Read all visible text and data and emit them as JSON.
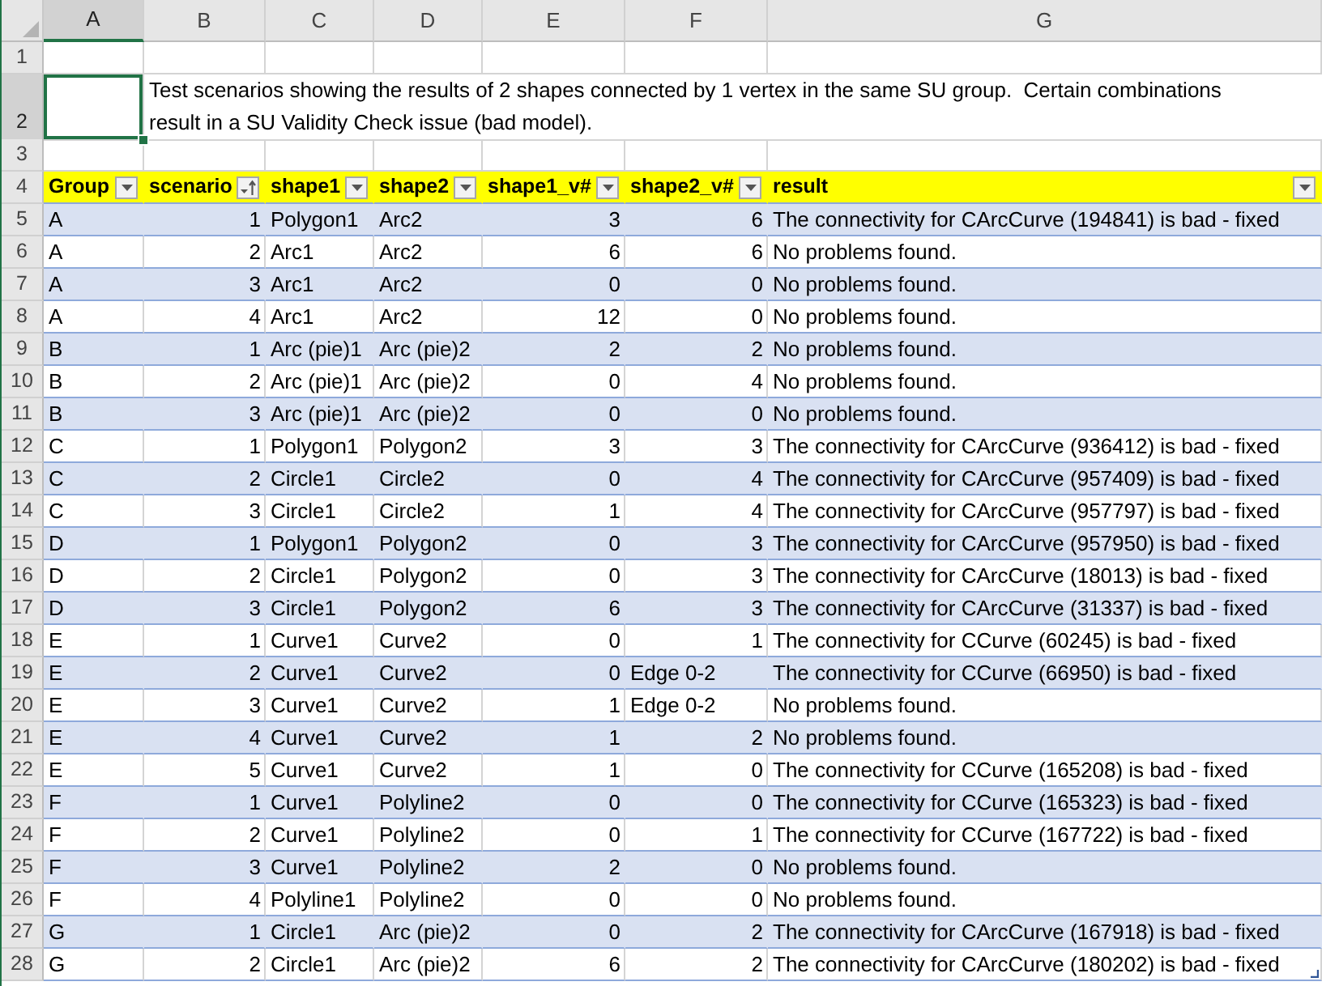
{
  "column_headers": [
    {
      "label": "A",
      "selected": true
    },
    {
      "label": "B",
      "selected": false
    },
    {
      "label": "C",
      "selected": false
    },
    {
      "label": "D",
      "selected": false
    },
    {
      "label": "E",
      "selected": false
    },
    {
      "label": "F",
      "selected": false
    },
    {
      "label": "G",
      "selected": false
    }
  ],
  "row_headers": [
    {
      "label": "1",
      "selected": false
    },
    {
      "label": "2",
      "selected": true
    },
    {
      "label": "3",
      "selected": false
    },
    {
      "label": "4",
      "selected": false
    },
    {
      "label": "5",
      "selected": false
    },
    {
      "label": "6",
      "selected": false
    },
    {
      "label": "7",
      "selected": false
    },
    {
      "label": "8",
      "selected": false
    },
    {
      "label": "9",
      "selected": false
    },
    {
      "label": "10",
      "selected": false
    },
    {
      "label": "11",
      "selected": false
    },
    {
      "label": "12",
      "selected": false
    },
    {
      "label": "13",
      "selected": false
    },
    {
      "label": "14",
      "selected": false
    },
    {
      "label": "15",
      "selected": false
    },
    {
      "label": "16",
      "selected": false
    },
    {
      "label": "17",
      "selected": false
    },
    {
      "label": "18",
      "selected": false
    },
    {
      "label": "19",
      "selected": false
    },
    {
      "label": "20",
      "selected": false
    },
    {
      "label": "21",
      "selected": false
    },
    {
      "label": "22",
      "selected": false
    },
    {
      "label": "23",
      "selected": false
    },
    {
      "label": "24",
      "selected": false
    },
    {
      "label": "25",
      "selected": false
    },
    {
      "label": "26",
      "selected": false
    },
    {
      "label": "27",
      "selected": false
    },
    {
      "label": "28",
      "selected": false
    }
  ],
  "note": "Test scenarios showing the results of 2 shapes connected by 1 vertex in the same SU group.  Certain combinations result in a SU Validity Check issue (bad model).",
  "table": {
    "columns": [
      {
        "label": "Group",
        "sorted": false
      },
      {
        "label": "scenario",
        "sorted": true
      },
      {
        "label": "shape1",
        "sorted": false
      },
      {
        "label": "shape2",
        "sorted": false
      },
      {
        "label": "shape1_v#",
        "sorted": false
      },
      {
        "label": "shape2_v#",
        "sorted": false
      },
      {
        "label": "result",
        "sorted": false
      }
    ],
    "rows": [
      {
        "cells": [
          {
            "text": "A",
            "kind": "text"
          },
          {
            "text": "1",
            "kind": "number"
          },
          {
            "text": "Polygon1",
            "kind": "text"
          },
          {
            "text": "Arc2",
            "kind": "text"
          },
          {
            "text": "3",
            "kind": "number"
          },
          {
            "text": "6",
            "kind": "number"
          },
          {
            "text": "The connectivity for CArcCurve (194841) is bad - fixed",
            "kind": "text"
          }
        ]
      },
      {
        "cells": [
          {
            "text": "A",
            "kind": "text"
          },
          {
            "text": "2",
            "kind": "number"
          },
          {
            "text": "Arc1",
            "kind": "text"
          },
          {
            "text": "Arc2",
            "kind": "text"
          },
          {
            "text": "6",
            "kind": "number"
          },
          {
            "text": "6",
            "kind": "number"
          },
          {
            "text": "No problems found.",
            "kind": "text"
          }
        ]
      },
      {
        "cells": [
          {
            "text": "A",
            "kind": "text"
          },
          {
            "text": "3",
            "kind": "number"
          },
          {
            "text": "Arc1",
            "kind": "text"
          },
          {
            "text": "Arc2",
            "kind": "text"
          },
          {
            "text": "0",
            "kind": "number"
          },
          {
            "text": "0",
            "kind": "number"
          },
          {
            "text": "No problems found.",
            "kind": "text"
          }
        ]
      },
      {
        "cells": [
          {
            "text": "A",
            "kind": "text"
          },
          {
            "text": "4",
            "kind": "number"
          },
          {
            "text": "Arc1",
            "kind": "text"
          },
          {
            "text": "Arc2",
            "kind": "text"
          },
          {
            "text": "12",
            "kind": "number"
          },
          {
            "text": "0",
            "kind": "number"
          },
          {
            "text": "No problems found.",
            "kind": "text"
          }
        ]
      },
      {
        "cells": [
          {
            "text": "B",
            "kind": "text"
          },
          {
            "text": "1",
            "kind": "number"
          },
          {
            "text": "Arc (pie)1",
            "kind": "text"
          },
          {
            "text": "Arc (pie)2",
            "kind": "text"
          },
          {
            "text": "2",
            "kind": "number"
          },
          {
            "text": "2",
            "kind": "number"
          },
          {
            "text": "No problems found.",
            "kind": "text"
          }
        ]
      },
      {
        "cells": [
          {
            "text": "B",
            "kind": "text"
          },
          {
            "text": "2",
            "kind": "number"
          },
          {
            "text": "Arc (pie)1",
            "kind": "text"
          },
          {
            "text": "Arc (pie)2",
            "kind": "text"
          },
          {
            "text": "0",
            "kind": "number"
          },
          {
            "text": "4",
            "kind": "number"
          },
          {
            "text": "No problems found.",
            "kind": "text"
          }
        ]
      },
      {
        "cells": [
          {
            "text": "B",
            "kind": "text"
          },
          {
            "text": "3",
            "kind": "number"
          },
          {
            "text": "Arc (pie)1",
            "kind": "text"
          },
          {
            "text": "Arc (pie)2",
            "kind": "text"
          },
          {
            "text": "0",
            "kind": "number"
          },
          {
            "text": "0",
            "kind": "number"
          },
          {
            "text": "No problems found.",
            "kind": "text"
          }
        ]
      },
      {
        "cells": [
          {
            "text": "C",
            "kind": "text"
          },
          {
            "text": "1",
            "kind": "number"
          },
          {
            "text": "Polygon1",
            "kind": "text"
          },
          {
            "text": "Polygon2",
            "kind": "text"
          },
          {
            "text": "3",
            "kind": "number"
          },
          {
            "text": "3",
            "kind": "number"
          },
          {
            "text": "The connectivity for CArcCurve (936412) is bad - fixed",
            "kind": "text"
          }
        ]
      },
      {
        "cells": [
          {
            "text": "C",
            "kind": "text"
          },
          {
            "text": "2",
            "kind": "number"
          },
          {
            "text": "Circle1",
            "kind": "text"
          },
          {
            "text": "Circle2",
            "kind": "text"
          },
          {
            "text": "0",
            "kind": "number"
          },
          {
            "text": "4",
            "kind": "number"
          },
          {
            "text": "The connectivity for CArcCurve (957409) is bad - fixed",
            "kind": "text"
          }
        ]
      },
      {
        "cells": [
          {
            "text": "C",
            "kind": "text"
          },
          {
            "text": "3",
            "kind": "number"
          },
          {
            "text": "Circle1",
            "kind": "text"
          },
          {
            "text": "Circle2",
            "kind": "text"
          },
          {
            "text": "1",
            "kind": "number"
          },
          {
            "text": "4",
            "kind": "number"
          },
          {
            "text": "The connectivity for CArcCurve (957797) is bad - fixed",
            "kind": "text"
          }
        ]
      },
      {
        "cells": [
          {
            "text": "D",
            "kind": "text"
          },
          {
            "text": "1",
            "kind": "number"
          },
          {
            "text": "Polygon1",
            "kind": "text"
          },
          {
            "text": "Polygon2",
            "kind": "text"
          },
          {
            "text": "0",
            "kind": "number"
          },
          {
            "text": "3",
            "kind": "number"
          },
          {
            "text": "The connectivity for CArcCurve (957950) is bad - fixed",
            "kind": "text"
          }
        ]
      },
      {
        "cells": [
          {
            "text": "D",
            "kind": "text"
          },
          {
            "text": "2",
            "kind": "number"
          },
          {
            "text": "Circle1",
            "kind": "text"
          },
          {
            "text": "Polygon2",
            "kind": "text"
          },
          {
            "text": "0",
            "kind": "number"
          },
          {
            "text": "3",
            "kind": "number"
          },
          {
            "text": "The connectivity for CArcCurve (18013) is bad - fixed",
            "kind": "text"
          }
        ]
      },
      {
        "cells": [
          {
            "text": "D",
            "kind": "text"
          },
          {
            "text": "3",
            "kind": "number"
          },
          {
            "text": "Circle1",
            "kind": "text"
          },
          {
            "text": "Polygon2",
            "kind": "text"
          },
          {
            "text": "6",
            "kind": "number"
          },
          {
            "text": "3",
            "kind": "number"
          },
          {
            "text": "The connectivity for CArcCurve (31337) is bad - fixed",
            "kind": "text"
          }
        ]
      },
      {
        "cells": [
          {
            "text": "E",
            "kind": "text"
          },
          {
            "text": "1",
            "kind": "number"
          },
          {
            "text": "Curve1",
            "kind": "text"
          },
          {
            "text": "Curve2",
            "kind": "text"
          },
          {
            "text": "0",
            "kind": "number"
          },
          {
            "text": "1",
            "kind": "number"
          },
          {
            "text": "The connectivity for CCurve (60245) is bad - fixed",
            "kind": "text"
          }
        ]
      },
      {
        "cells": [
          {
            "text": "E",
            "kind": "text"
          },
          {
            "text": "2",
            "kind": "number"
          },
          {
            "text": "Curve1",
            "kind": "text"
          },
          {
            "text": "Curve2",
            "kind": "text"
          },
          {
            "text": "0",
            "kind": "number"
          },
          {
            "text": "Edge 0-2",
            "kind": "text"
          },
          {
            "text": "The connectivity for CCurve (66950) is bad - fixed",
            "kind": "text"
          }
        ]
      },
      {
        "cells": [
          {
            "text": "E",
            "kind": "text"
          },
          {
            "text": "3",
            "kind": "number"
          },
          {
            "text": "Curve1",
            "kind": "text"
          },
          {
            "text": "Curve2",
            "kind": "text"
          },
          {
            "text": "1",
            "kind": "number"
          },
          {
            "text": "Edge 0-2",
            "kind": "text"
          },
          {
            "text": "No problems found.",
            "kind": "text"
          }
        ]
      },
      {
        "cells": [
          {
            "text": "E",
            "kind": "text"
          },
          {
            "text": "4",
            "kind": "number"
          },
          {
            "text": "Curve1",
            "kind": "text"
          },
          {
            "text": "Curve2",
            "kind": "text"
          },
          {
            "text": "1",
            "kind": "number"
          },
          {
            "text": "2",
            "kind": "number"
          },
          {
            "text": "No problems found.",
            "kind": "text"
          }
        ]
      },
      {
        "cells": [
          {
            "text": "E",
            "kind": "text"
          },
          {
            "text": "5",
            "kind": "number"
          },
          {
            "text": "Curve1",
            "kind": "text"
          },
          {
            "text": "Curve2",
            "kind": "text"
          },
          {
            "text": "1",
            "kind": "number"
          },
          {
            "text": "0",
            "kind": "number"
          },
          {
            "text": "The connectivity for CCurve (165208) is bad - fixed",
            "kind": "text"
          }
        ]
      },
      {
        "cells": [
          {
            "text": "F",
            "kind": "text"
          },
          {
            "text": "1",
            "kind": "number"
          },
          {
            "text": "Curve1",
            "kind": "text"
          },
          {
            "text": "Polyline2",
            "kind": "text"
          },
          {
            "text": "0",
            "kind": "number"
          },
          {
            "text": "0",
            "kind": "number"
          },
          {
            "text": "The connectivity for CCurve (165323) is bad - fixed",
            "kind": "text"
          }
        ]
      },
      {
        "cells": [
          {
            "text": "F",
            "kind": "text"
          },
          {
            "text": "2",
            "kind": "number"
          },
          {
            "text": "Curve1",
            "kind": "text"
          },
          {
            "text": "Polyline2",
            "kind": "text"
          },
          {
            "text": "0",
            "kind": "number"
          },
          {
            "text": "1",
            "kind": "number"
          },
          {
            "text": "The connectivity for CCurve (167722) is bad - fixed",
            "kind": "text"
          }
        ]
      },
      {
        "cells": [
          {
            "text": "F",
            "kind": "text"
          },
          {
            "text": "3",
            "kind": "number"
          },
          {
            "text": "Curve1",
            "kind": "text"
          },
          {
            "text": "Polyline2",
            "kind": "text"
          },
          {
            "text": "2",
            "kind": "number"
          },
          {
            "text": "0",
            "kind": "number"
          },
          {
            "text": "No problems found.",
            "kind": "text"
          }
        ]
      },
      {
        "cells": [
          {
            "text": "F",
            "kind": "text"
          },
          {
            "text": "4",
            "kind": "number"
          },
          {
            "text": "Polyline1",
            "kind": "text"
          },
          {
            "text": "Polyline2",
            "kind": "text"
          },
          {
            "text": "0",
            "kind": "number"
          },
          {
            "text": "0",
            "kind": "number"
          },
          {
            "text": "No problems found.",
            "kind": "text"
          }
        ]
      },
      {
        "cells": [
          {
            "text": "G",
            "kind": "text"
          },
          {
            "text": "1",
            "kind": "number"
          },
          {
            "text": "Circle1",
            "kind": "text"
          },
          {
            "text": "Arc (pie)2",
            "kind": "text"
          },
          {
            "text": "0",
            "kind": "number"
          },
          {
            "text": "2",
            "kind": "number"
          },
          {
            "text": "The connectivity for CArcCurve (167918) is bad - fixed",
            "kind": "text"
          }
        ]
      },
      {
        "cells": [
          {
            "text": "G",
            "kind": "text"
          },
          {
            "text": "2",
            "kind": "number"
          },
          {
            "text": "Circle1",
            "kind": "text"
          },
          {
            "text": "Arc (pie)2",
            "kind": "text"
          },
          {
            "text": "6",
            "kind": "number"
          },
          {
            "text": "2",
            "kind": "number"
          },
          {
            "text": "The connectivity for CArcCurve (180202) is bad - fixed",
            "kind": "text"
          }
        ]
      }
    ]
  }
}
